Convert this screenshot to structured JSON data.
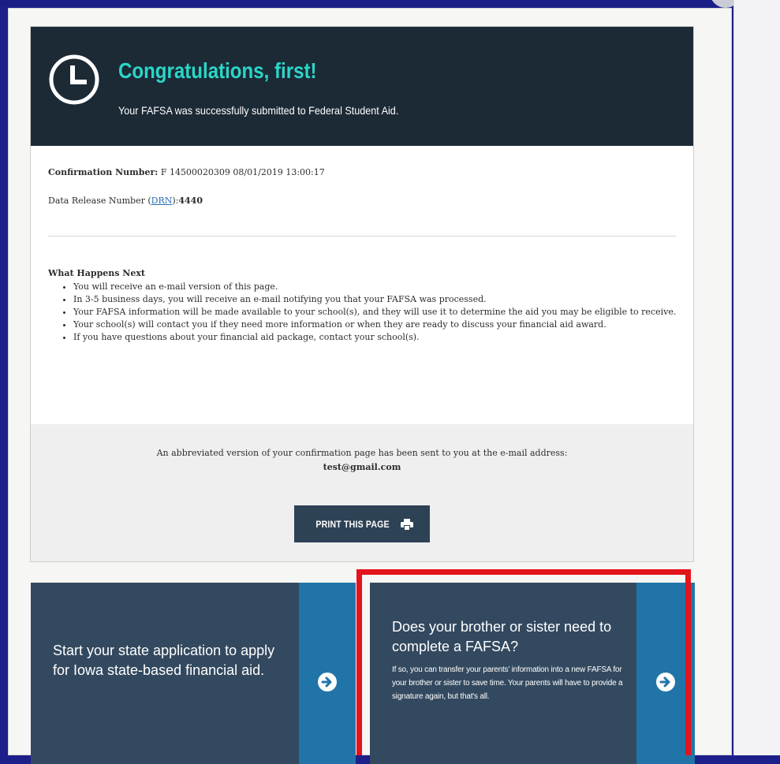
{
  "hero": {
    "title": "Congratulations, first!",
    "subtitle": "Your FAFSA was successfully submitted to Federal Student Aid."
  },
  "confirmation": {
    "label": "Confirmation Number:",
    "value": "F 14500020309 08/01/2019 13:00:17"
  },
  "drn": {
    "prefix": "Data Release Number (",
    "link": "DRN",
    "suffix": "):",
    "value": "4440"
  },
  "next_steps": {
    "title": "What Happens Next",
    "items": [
      "You will receive an e-mail version of this page.",
      "In 3-5 business days, you will receive an e-mail notifying you that your FAFSA was processed.",
      "Your FAFSA information will be made available to your school(s), and they will use it to determine the aid you may be eligible to receive.",
      "Your school(s) will contact you if they need more information or when they are ready to discuss your financial aid award.",
      "If you have questions about your financial aid package, contact your school(s)."
    ]
  },
  "email": {
    "note": "An abbreviated version of your confirmation page has been sent to you at the e-mail address:",
    "address": "test@gmail.com"
  },
  "print_button": {
    "label": "PRINT THIS PAGE",
    "icon": "printer-icon"
  },
  "tiles": {
    "state": {
      "text": "Start your state application to apply for Iowa state-based financial aid.",
      "icon": "arrow-right-circle-icon"
    },
    "sibling": {
      "title": "Does your brother or sister need to complete a FAFSA?",
      "description": "If so, you can transfer your parents' information into a new FAFSA for your brother or sister to save time. Your parents will have to provide a signature again, but that's all.",
      "icon": "arrow-right-circle-icon"
    }
  },
  "colors": {
    "hero_bg": "#1c2a36",
    "hero_title": "#2bd6c7",
    "tile_bg": "#33495f",
    "tile_strip": "#2174a8",
    "highlight": "#e3141c",
    "backdrop": "#1d1f8a"
  }
}
